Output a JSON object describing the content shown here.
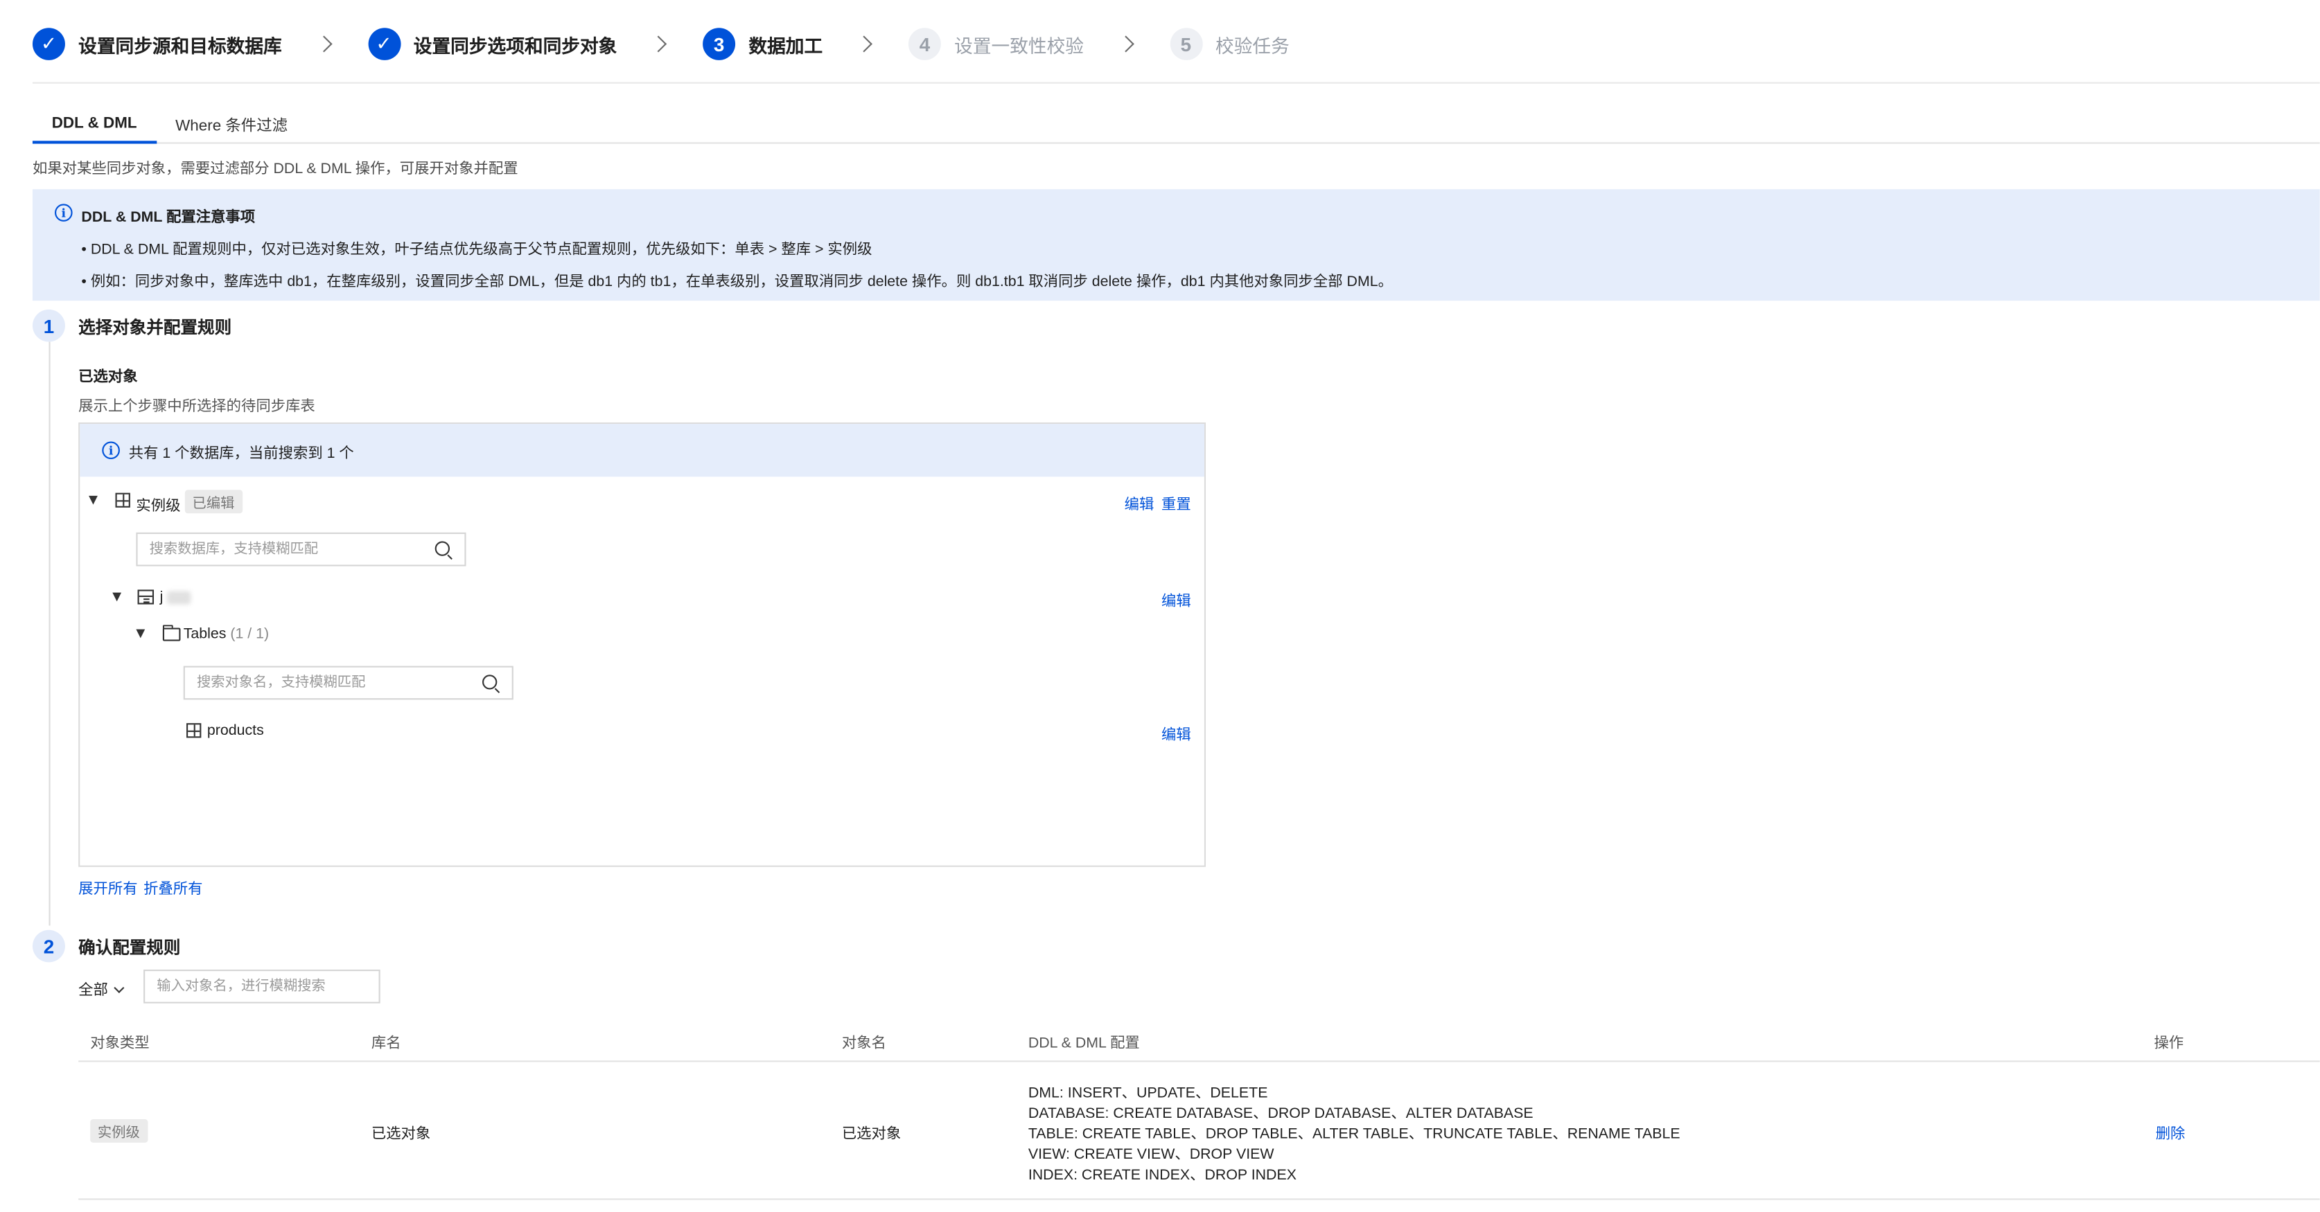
{
  "steps": [
    {
      "num": "✓",
      "label": "设置同步源和目标数据库",
      "state": "done"
    },
    {
      "num": "✓",
      "label": "设置同步选项和同步对象",
      "state": "done"
    },
    {
      "num": "3",
      "label": "数据加工",
      "state": "active"
    },
    {
      "num": "4",
      "label": "设置一致性校验",
      "state": "todo"
    },
    {
      "num": "5",
      "label": "校验任务",
      "state": "todo"
    }
  ],
  "tabs": [
    {
      "label": "DDL & DML",
      "active": true
    },
    {
      "label": "Where 条件过滤",
      "active": false
    }
  ],
  "hint": "如果对某些同步对象，需要过滤部分 DDL & DML 操作，可展开对象并配置",
  "notice": {
    "title": "DDL & DML 配置注意事项",
    "line1": "• DDL & DML 配置规则中，仅对已选对象生效，叶子结点优先级高于父节点配置规则，优先级如下：单表 > 整库 > 实例级",
    "line2": "• 例如：同步对象中，整库选中 db1，在整库级别，设置同步全部 DML，但是 db1 内的 tb1，在单表级别，设置取消同步 delete 操作。则 db1.tb1 取消同步 delete 操作，db1 内其他对象同步全部 DML。"
  },
  "section1": {
    "num": "1",
    "title": "选择对象并配置规则",
    "sub_title": "已选对象",
    "sub_desc": "展示上个步骤中所选择的待同步库表",
    "banner": "共有 1 个数据库，当前搜索到 1 个",
    "instance": {
      "label": "实例级",
      "tag": "已编辑",
      "edit": "编辑",
      "reset": "重置"
    },
    "db_search_placeholder": "搜索数据库，支持模糊匹配",
    "database": {
      "label": "j",
      "edit": "编辑"
    },
    "tables_folder": {
      "label": "Tables",
      "count": "(1 / 1)"
    },
    "obj_search_placeholder": "搜索对象名，支持模糊匹配",
    "table": {
      "label": "products",
      "edit": "编辑"
    },
    "expand_all": "展开所有",
    "collapse_all": "折叠所有"
  },
  "section2": {
    "num": "2",
    "title": "确认配置规则",
    "filter": "全部",
    "search_placeholder": "输入对象名，进行模糊搜索",
    "columns": [
      "对象类型",
      "库名",
      "对象名",
      "DDL & DML 配置",
      "操作"
    ],
    "row": {
      "type": "实例级",
      "db": "已选对象",
      "obj": "已选对象",
      "config": [
        "DML: INSERT、UPDATE、DELETE",
        "DATABASE: CREATE DATABASE、DROP DATABASE、ALTER DATABASE",
        "TABLE: CREATE TABLE、DROP TABLE、ALTER TABLE、TRUNCATE TABLE、RENAME TABLE",
        "VIEW: CREATE VIEW、DROP VIEW",
        "INDEX: CREATE INDEX、DROP INDEX"
      ],
      "action": "删除"
    }
  },
  "colors": {
    "primary": "#0052d9",
    "info_bg": "#e5edfb"
  }
}
